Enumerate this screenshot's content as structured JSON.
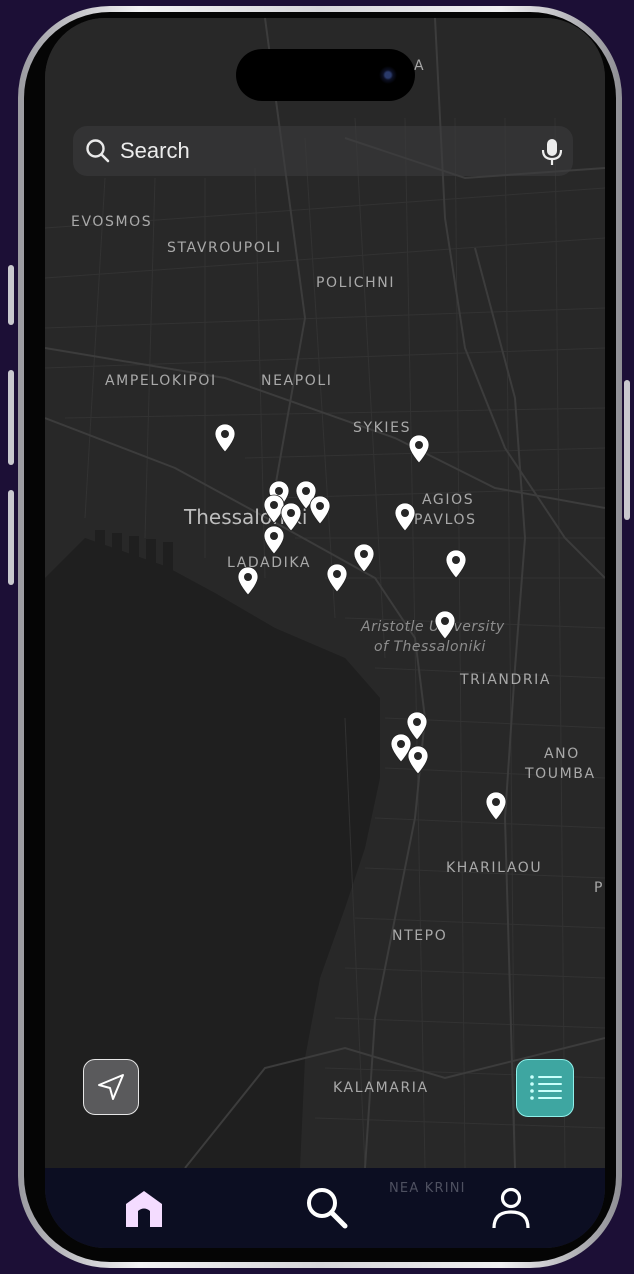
{
  "app": {
    "search": {
      "placeholder": "Search"
    },
    "map": {
      "labels": {
        "evosmos": "EVOSMOS",
        "stavroupoli": "STAVROUPOLI",
        "polichni": "POLICHNI",
        "ampelokipoi": "AMPELOKIPOI",
        "neapoli": "NEAPOLI",
        "sykies": "SYKIES",
        "thessaloniki": "Thessaloniki",
        "agios": "AGIOS",
        "pavlos": "PAVLOS",
        "ladadika": "LADADIKA",
        "aristotle_1": "Aristotle University",
        "aristotle_2": "of Thessaloniki",
        "triandria": "TRIANDRIA",
        "ano": "ANO",
        "toumba": "TOUMBA",
        "kharilaou": "KHARILAOU",
        "ntepo": "NTEPO",
        "kalamaria": "KALAMARIA",
        "nea_krini": "NEA KRINI",
        "top_partial": "A",
        "right_partial": "P"
      },
      "pin_icon": "map-pin-icon",
      "pin_color": "#ffffff"
    },
    "buttons": {
      "locate_icon": "navigation-arrow-icon",
      "list_icon": "list-icon"
    },
    "tabs": [
      {
        "name": "home",
        "icon": "home-icon",
        "color": "#f4dcff"
      },
      {
        "name": "search",
        "icon": "search-icon",
        "color": "#ffffff"
      },
      {
        "name": "profile",
        "icon": "user-icon",
        "color": "#ffffff"
      }
    ],
    "colors": {
      "background": "#1c0f36",
      "map": "#262626",
      "water": "#1f1f1f",
      "accent": "#3ea6a1",
      "tabbar": "#0c0e22"
    }
  }
}
